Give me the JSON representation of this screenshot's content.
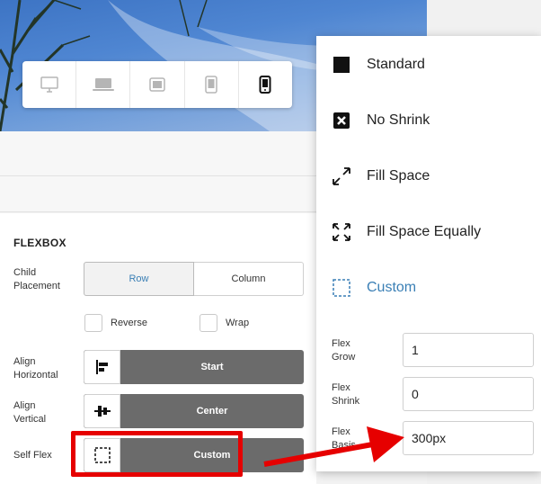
{
  "device_bar": {
    "devices": [
      {
        "icon": "desktop-icon"
      },
      {
        "icon": "laptop-icon"
      },
      {
        "icon": "tablet-landscape-icon"
      },
      {
        "icon": "tablet-portrait-icon"
      },
      {
        "icon": "mobile-icon",
        "active": true
      }
    ]
  },
  "flexbox": {
    "title": "FLEXBOX",
    "child_placement": {
      "label": "Child Placement",
      "options": [
        "Row",
        "Column"
      ],
      "selected": "Row"
    },
    "reverse_label": "Reverse",
    "wrap_label": "Wrap",
    "align_horizontal": {
      "label": "Align Horizontal",
      "value": "Start",
      "icon": "align-start-icon"
    },
    "align_vertical": {
      "label": "Align Vertical",
      "value": "Center",
      "icon": "align-center-icon"
    },
    "self_flex": {
      "label": "Self Flex",
      "value": "Custom",
      "icon": "custom-dashed-icon"
    }
  },
  "self_flex_menu": {
    "items": [
      {
        "label": "Standard",
        "icon": "square-icon"
      },
      {
        "label": "No Shrink",
        "icon": "x-square-icon"
      },
      {
        "label": "Fill Space",
        "icon": "expand-icon"
      },
      {
        "label": "Fill Space Equally",
        "icon": "expand-corners-icon"
      },
      {
        "label": "Custom",
        "icon": "dashed-square-icon",
        "selected": true
      }
    ],
    "fields": {
      "grow": {
        "label": "Flex Grow",
        "value": "1"
      },
      "shrink": {
        "label": "Flex Shrink",
        "value": "0"
      },
      "basis": {
        "label": "Flex Basis",
        "value": "300px"
      }
    }
  },
  "colors": {
    "accent": "#3a7fb5",
    "annotation_red": "#e60000",
    "dropdown_gray": "#6b6b6b"
  }
}
